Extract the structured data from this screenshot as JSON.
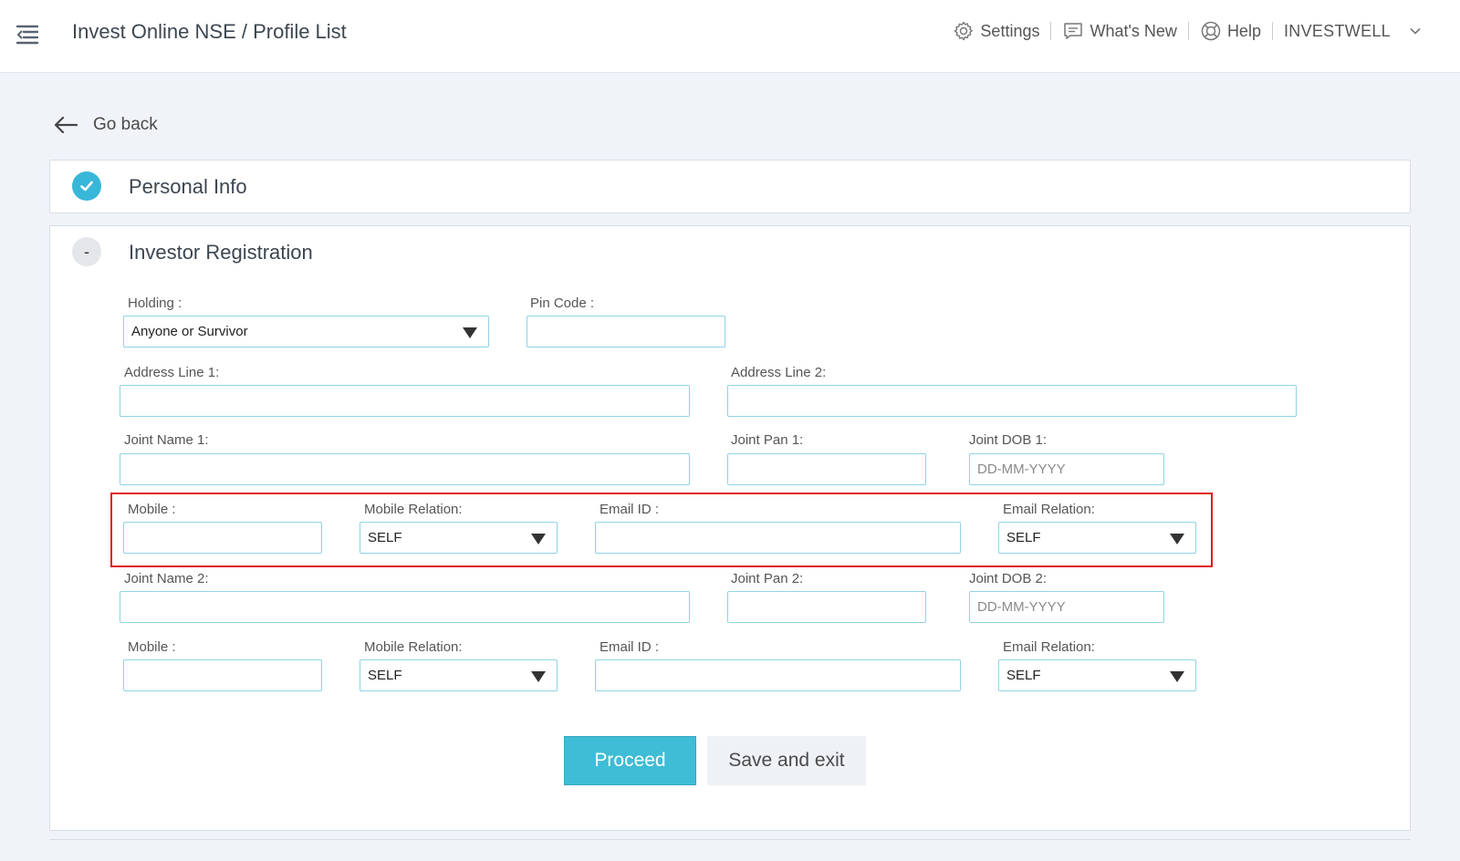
{
  "header": {
    "title": "Invest Online NSE / Profile List",
    "links": {
      "settings": "Settings",
      "whats_new": "What's New",
      "help": "Help",
      "user": "INVESTWELL"
    }
  },
  "nav": {
    "go_back": "Go back"
  },
  "sections": {
    "personal_info": "Personal Info",
    "investor_registration": "Investor Registration",
    "collapse_symbol": "-"
  },
  "form": {
    "holding": {
      "label": "Holding :",
      "value": "Anyone or Survivor"
    },
    "pin_code": {
      "label": "Pin Code :",
      "value": ""
    },
    "address_line_1": {
      "label": "Address Line 1:",
      "value": ""
    },
    "address_line_2": {
      "label": "Address Line 2:",
      "value": ""
    },
    "joint_1": {
      "name_label": "Joint Name 1:",
      "pan_label": "Joint Pan 1:",
      "dob_label": "Joint DOB 1:",
      "dob_placeholder": "DD-MM-YYYY",
      "mobile_label": "Mobile :",
      "mobile_relation_label": "Mobile Relation:",
      "mobile_relation_value": "SELF",
      "email_label": "Email ID :",
      "email_relation_label": "Email Relation:",
      "email_relation_value": "SELF"
    },
    "joint_2": {
      "name_label": "Joint Name 2:",
      "pan_label": "Joint Pan 2:",
      "dob_label": "Joint DOB 2:",
      "dob_placeholder": "DD-MM-YYYY",
      "mobile_label": "Mobile :",
      "mobile_relation_label": "Mobile Relation:",
      "mobile_relation_value": "SELF",
      "email_label": "Email ID :",
      "email_relation_label": "Email Relation:",
      "email_relation_value": "SELF"
    }
  },
  "buttons": {
    "proceed": "Proceed",
    "save_exit": "Save and exit"
  },
  "colors": {
    "accent": "#3fbcd6",
    "highlight_border": "#e0161c",
    "input_border": "#8fd3e6"
  }
}
